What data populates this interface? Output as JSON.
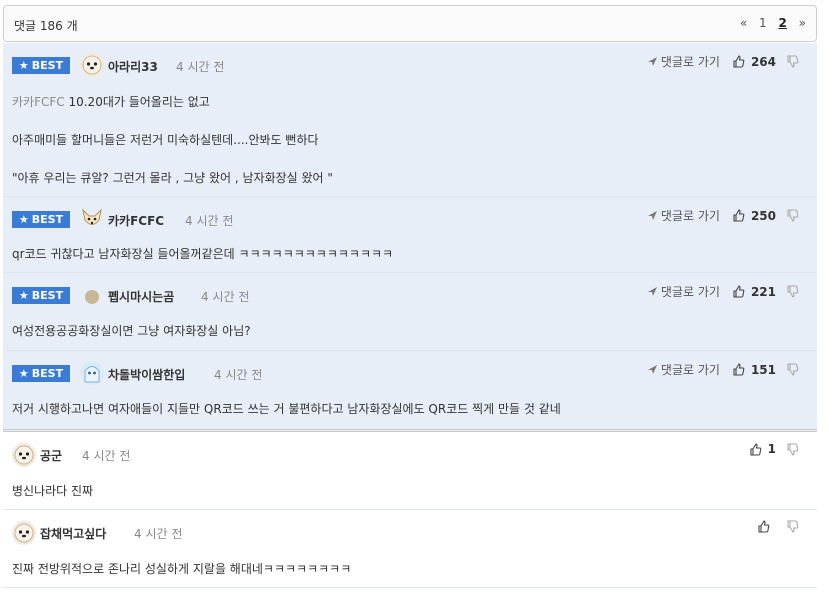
{
  "header": {
    "title": "댓글 186 개",
    "pager": {
      "prev": "«",
      "pages": [
        "1",
        "2"
      ],
      "current": "2",
      "next": "»"
    }
  },
  "labels": {
    "best": "BEST",
    "reply": "댓글로 가기"
  },
  "best_comments": [
    {
      "nick": "아라리33",
      "time": "4 시간 전",
      "likes": "264",
      "quote_prefix": "카카FCFC",
      "line1": " 10.20대가 들어올리는 없고",
      "line2": "아주매미들 할머니들은 저런거 미숙하실텐데....안봐도 뻔하다",
      "line3": "\"아휴 우리는 큐알? 그런거 몰라 , 그냥 왔어 , 남자화장실 왔어 \""
    },
    {
      "nick": "카카FCFC",
      "time": "4 시간 전",
      "likes": "250",
      "line1": "qr코드 귀찮다고 남자화장실 들어올꺼같은데 ㅋㅋㅋㅋㅋㅋㅋㅋㅋㅋㅋㅋㅋㅋ"
    },
    {
      "nick": "펩시마시는곰",
      "time": "4 시간 전",
      "likes": "221",
      "line1": "여성전용공공화장실이면 그냥 여자화장실 아님?"
    },
    {
      "nick": "차돌박이쌈한입",
      "time": "4 시간 전",
      "likes": "151",
      "line1": "저거 시행하고나면 여자애들이 지들만 QR코드 쓰는 거 불편하다고 남자화장실에도 QR코드 찍게 만들 것 같네"
    }
  ],
  "comments": [
    {
      "nick": "공군",
      "time": "4 시간 전",
      "likes": "1",
      "line1": "병신나라다 진짜"
    },
    {
      "nick": "잡채먹고싶다",
      "time": "4 시간 전",
      "likes": "",
      "line1": "진짜 전방위적으로 존나리 성실하게 지랄을 해대네ㅋㅋㅋㅋㅋㅋㅋㅋ"
    }
  ],
  "colors": {
    "best_bg": "#e8eef7",
    "badge": "#3a7bd5"
  }
}
